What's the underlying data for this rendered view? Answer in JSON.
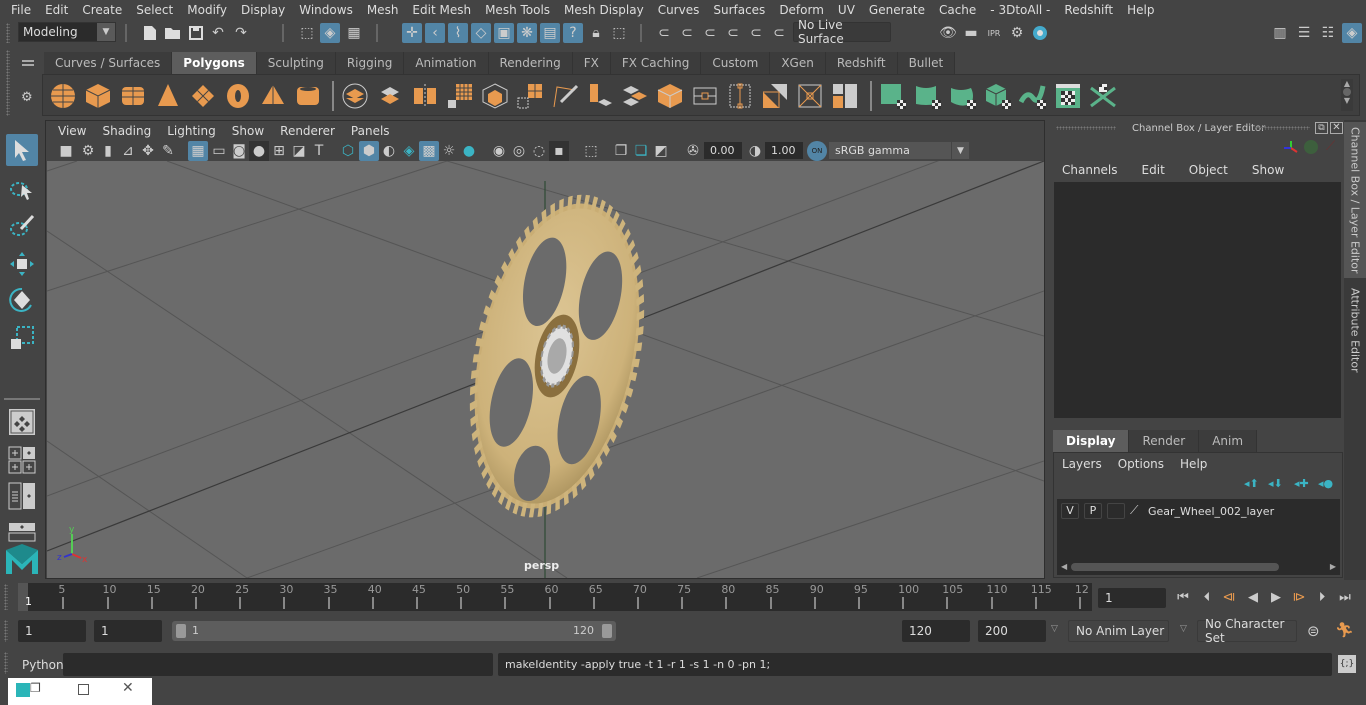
{
  "menubar": {
    "items": [
      "File",
      "Edit",
      "Create",
      "Select",
      "Modify",
      "Display",
      "Windows",
      "Mesh",
      "Edit Mesh",
      "Mesh Tools",
      "Mesh Display",
      "Curves",
      "Surfaces",
      "Deform",
      "UV",
      "Generate",
      "Cache",
      "- 3DtoAll -",
      "Redshift",
      "Help"
    ]
  },
  "statusline": {
    "mode_dropdown": "Modeling",
    "live_surface": "No Live Surface",
    "icons": [
      "new-scene",
      "open-scene",
      "save-scene",
      "undo",
      "redo",
      "select-by-hierarchy",
      "select-by-object",
      "select-by-component",
      "snap-grid",
      "snap-curve",
      "snap-point",
      "snap-projected-center",
      "snap-view-plane",
      "make-live",
      "history",
      "help",
      "lock",
      "selection-lock",
      "render-view",
      "render-current",
      "ipr-render",
      "render-settings",
      "hypershade"
    ]
  },
  "shelf": {
    "tabs": [
      "Curves / Surfaces",
      "Polygons",
      "Sculpting",
      "Rigging",
      "Animation",
      "Rendering",
      "FX",
      "FX Caching",
      "Custom",
      "XGen",
      "Redshift",
      "Bullet"
    ],
    "active_tab": "Polygons",
    "poly_colors": {
      "orange": "#e89a4f",
      "green": "#5ab38a"
    }
  },
  "toolbox": {
    "tools": [
      "select-tool",
      "lasso-tool",
      "paint-select-tool",
      "move-tool",
      "rotate-tool",
      "scale-tool"
    ],
    "layouts": [
      "single-view-layout",
      "four-view-layout",
      "outliner-persp-layout",
      "persp-graph-layout"
    ]
  },
  "viewport": {
    "menu": [
      "View",
      "Shading",
      "Lighting",
      "Show",
      "Renderer",
      "Panels"
    ],
    "exposure": "0.00",
    "gamma": "1.00",
    "color_space": "sRGB gamma",
    "camera_label": "persp",
    "axis": {
      "x": "x",
      "y": "y",
      "z": "z"
    }
  },
  "channelbox": {
    "title": "Channel Box / Layer Editor",
    "menu": [
      "Channels",
      "Edit",
      "Object",
      "Show"
    ],
    "layer_tabs": [
      "Display",
      "Render",
      "Anim"
    ],
    "active_layer_tab": "Display",
    "layer_menu": [
      "Layers",
      "Options",
      "Help"
    ],
    "layers": [
      {
        "v": "V",
        "p": "P",
        "name": "Gear_Wheel_002_layer"
      }
    ]
  },
  "right_tabs": [
    "Channel Box / Layer Editor",
    "Attribute Editor"
  ],
  "timeline": {
    "ticks": [
      5,
      10,
      15,
      20,
      25,
      30,
      35,
      40,
      45,
      50,
      55,
      60,
      65,
      70,
      75,
      80,
      85,
      90,
      95,
      100,
      105,
      110,
      115,
      "12"
    ],
    "current_marker": "1",
    "current_frame": "1"
  },
  "range": {
    "start": "1",
    "playback_start": "1",
    "slider_start": "1",
    "slider_end": "120",
    "playback_end": "120",
    "end": "200",
    "anim_layer": "No Anim Layer",
    "character_set": "No Character Set"
  },
  "commandline": {
    "language": "Python",
    "input": "",
    "result": "makeIdentity -apply true -t 1 -r 1 -s 1 -n 0 -pn 1;"
  }
}
